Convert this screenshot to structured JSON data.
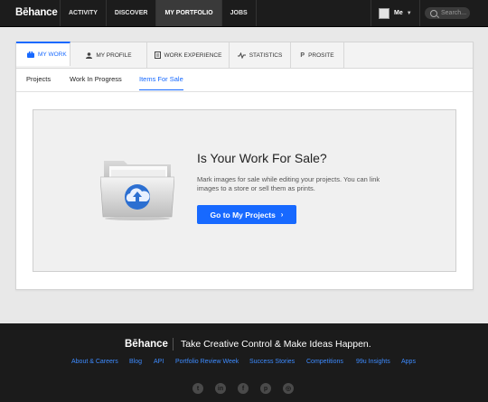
{
  "topnav": {
    "logo": "Bēhance",
    "items": [
      "ACTIVITY",
      "DISCOVER",
      "MY PORTFOLIO",
      "JOBS"
    ],
    "active_item": "MY PORTFOLIO",
    "me_label": "Me",
    "search_placeholder": "Search..."
  },
  "tabs": [
    {
      "label": "MY WORK",
      "icon": "briefcase-icon"
    },
    {
      "label": "MY PROFILE",
      "icon": "person-icon"
    },
    {
      "label": "WORK EXPERIENCE",
      "icon": "document-icon"
    },
    {
      "label": "STATISTICS",
      "icon": "pulse-icon"
    },
    {
      "label": "PROSITE",
      "icon": "prosite-icon"
    }
  ],
  "active_tab": "MY WORK",
  "subtabs": [
    "Projects",
    "Work In Progress",
    "Items For Sale"
  ],
  "active_subtab": "Items For Sale",
  "empty_state": {
    "headline": "Is Your Work For Sale?",
    "description": "Mark images for sale while editing your projects. You can link images to a store or sell them as prints.",
    "cta_label": "Go to My Projects"
  },
  "footer": {
    "logo": "Bēhance",
    "tagline": "Take Creative Control & Make Ideas Happen.",
    "links": [
      "About & Careers",
      "Blog",
      "API",
      "Portfolio Review Week",
      "Success Stories",
      "Competitions",
      "99u Insights",
      "Apps"
    ],
    "social": [
      "twitter-icon",
      "linkedin-icon",
      "facebook-icon",
      "pinterest-icon",
      "instagram-icon"
    ]
  },
  "colors": {
    "accent": "#1769ff",
    "topbar": "#1c1c1c",
    "footer": "#1b1b1b"
  }
}
